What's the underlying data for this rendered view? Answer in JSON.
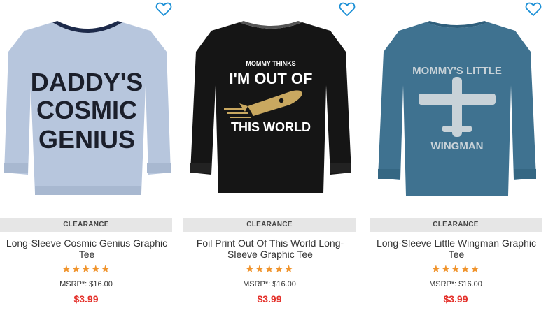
{
  "products": [
    {
      "badge": "CLEARANCE",
      "name": "Long-Sleeve Cosmic Genius Graphic Tee",
      "rating": 5,
      "stars": "★★★★★",
      "msrp": "MSRP*: $16.00",
      "price": "$3.99",
      "shirt_graphic": {
        "lines": [
          "DADDY'S",
          "COSMIC",
          "GENIUS"
        ]
      },
      "colors": {
        "shirt": "#b7c6dd",
        "trim": "#1d2a4a"
      }
    },
    {
      "badge": "CLEARANCE",
      "name": "Foil Print Out Of This World Long-Sleeve Graphic Tee",
      "rating": 5,
      "stars": "★★★★★",
      "msrp": "MSRP*: $16.00",
      "price": "$3.99",
      "shirt_graphic": {
        "lines": [
          "MOMMY THINKS",
          "I'M OUT OF",
          "THIS WORLD"
        ]
      },
      "colors": {
        "shirt": "#151515",
        "trim": "#2a2a2a"
      }
    },
    {
      "badge": "CLEARANCE",
      "name": "Long-Sleeve Little Wingman Graphic Tee",
      "rating": 5,
      "stars": "★★★★★",
      "msrp": "MSRP*: $16.00",
      "price": "$3.99",
      "shirt_graphic": {
        "lines": [
          "MOMMY'S LITTLE",
          "WINGMAN"
        ]
      },
      "colors": {
        "shirt": "#3f7290",
        "trim": "#3a6a86"
      }
    }
  ],
  "icons": {
    "favorite": "heart-outline-icon"
  },
  "colors": {
    "accent_price": "#e4312b",
    "star": "#f0932b",
    "heart": "#1a8fd6",
    "badge_bg": "#e6e6e6"
  }
}
